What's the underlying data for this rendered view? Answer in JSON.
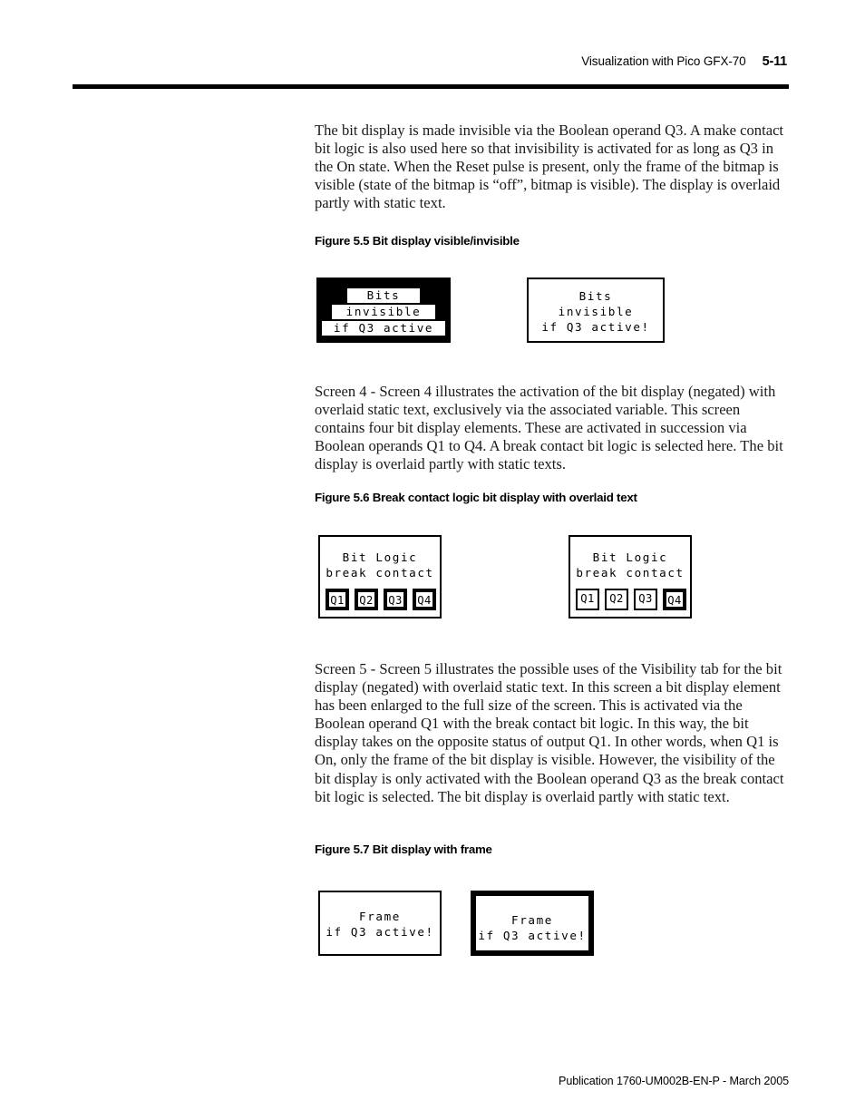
{
  "header": {
    "title": "Visualization with Pico GFX-70",
    "page_number": "5-11"
  },
  "footer": {
    "publication": "Publication 1760-UM002B-EN-P - March 2005"
  },
  "body": {
    "paragraph_1": "The bit display is made invisible via the Boolean operand Q3. A make contact bit logic is also used here so that invisibility is activated for as long as Q3 in the On state. When the Reset pulse is present, only the frame of the bitmap is visible (state of the bitmap is “off”, bitmap is visible). The display is overlaid partly with static text.",
    "paragraph_2": "Screen 4 - Screen 4 illustrates the activation of the bit display (negated) with overlaid static text, exclusively via the associated variable. This screen contains four bit display elements. These are activated in succession via Boolean operands Q1 to Q4. A break contact bit logic is selected here. The bit display is overlaid partly with static texts.",
    "paragraph_3": "Screen 5 - Screen 5 illustrates the possible uses of the Visibility tab for the bit display (negated) with overlaid static text. In this screen a bit display element has been enlarged to the full size of the screen. This is activated via the Boolean operand Q1 with the break contact bit logic. In this way, the bit display takes on the opposite status of output Q1. In other words, when Q1 is On, only the frame of the bit display is visible. However, the visibility of the bit display is only activated with the Boolean operand Q3 as the break contact bit logic is selected. The bit display is overlaid partly with static text."
  },
  "figures": {
    "fig_55": {
      "caption": "Figure 5.5 Bit display visible/invisible",
      "left_display": {
        "style": "inverted",
        "lines": [
          "Bits",
          "invisible",
          "if Q3 active"
        ]
      },
      "right_display": {
        "style": "normal",
        "lines": [
          "Bits",
          "invisible",
          "if Q3 active!"
        ]
      }
    },
    "fig_56": {
      "caption": "Figure 5.6 Break contact logic bit display with overlaid text",
      "left_display": {
        "lines": [
          "Bit Logic",
          "break contact"
        ],
        "boxes": [
          {
            "label": "Q1",
            "style": "thick"
          },
          {
            "label": "Q2",
            "style": "thick"
          },
          {
            "label": "Q3",
            "style": "thick"
          },
          {
            "label": "Q4",
            "style": "thick"
          }
        ]
      },
      "right_display": {
        "lines": [
          "Bit Logic",
          "break contact"
        ],
        "boxes": [
          {
            "label": "Q1",
            "style": "thin"
          },
          {
            "label": "Q2",
            "style": "thin"
          },
          {
            "label": "Q3",
            "style": "thin"
          },
          {
            "label": "Q4",
            "style": "thick"
          }
        ]
      }
    },
    "fig_57": {
      "caption": "Figure 5.7 Bit display with frame",
      "left_display": {
        "frame": "thin",
        "lines": [
          "Frame",
          "if Q3 active!"
        ]
      },
      "right_display": {
        "frame": "thick",
        "lines": [
          "Frame",
          "if Q3 active!"
        ]
      }
    }
  },
  "colors": {
    "ink": "#000000",
    "paper": "#ffffff"
  }
}
